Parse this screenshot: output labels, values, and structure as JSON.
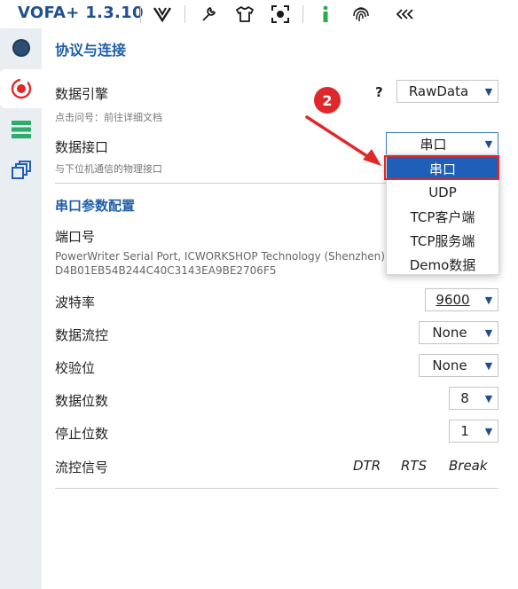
{
  "app": {
    "title": "VOFA+ 1.3.10"
  },
  "toolbar": {
    "icons": [
      "vofa-logo-icon",
      "wrench-icon",
      "tshirt-icon",
      "screenshot-icon",
      "info-icon",
      "fingerprint-icon",
      "collapse-icon"
    ]
  },
  "sidebar": {
    "items": [
      "connection-status-icon",
      "protocol-connection-icon",
      "data-list-icon",
      "windows-icon"
    ]
  },
  "protocol": {
    "section_title": "协议与连接",
    "engine_label": "数据引擎",
    "engine_hint": "点击问号：前往详细文档",
    "help_mark": "?",
    "engine_value": "RawData",
    "interface_label": "数据接口",
    "interface_hint": "与下位机通信的物理接口",
    "interface_value": "串口"
  },
  "dropdown": {
    "options": [
      "串口",
      "UDP",
      "TCP客户端",
      "TCP服务端",
      "Demo数据"
    ]
  },
  "serial": {
    "section_title": "串口参数配置",
    "port_label": "端口号",
    "port_desc_line1": "PowerWriter Serial Port, ICWORKSHOP Technology (Shenzhen) C",
    "port_desc_line2": "D4B01EB54B244C40C3143EA9BE2706F5",
    "baud_label": "波特率",
    "baud_value": "9600",
    "flow_label": "数据流控",
    "flow_value": "None",
    "parity_label": "校验位",
    "parity_value": "None",
    "databits_label": "数据位数",
    "databits_value": "8",
    "stopbits_label": "停止位数",
    "stopbits_value": "1",
    "signal_label": "流控信号",
    "signals": [
      "DTR",
      "RTS",
      "Break"
    ]
  },
  "annotation": {
    "badge": "2"
  },
  "colors": {
    "accent": "#1f5fa8",
    "selected": "#1f5fb8",
    "annotation": "#e0282b",
    "sidebar": "#e9eef3"
  }
}
